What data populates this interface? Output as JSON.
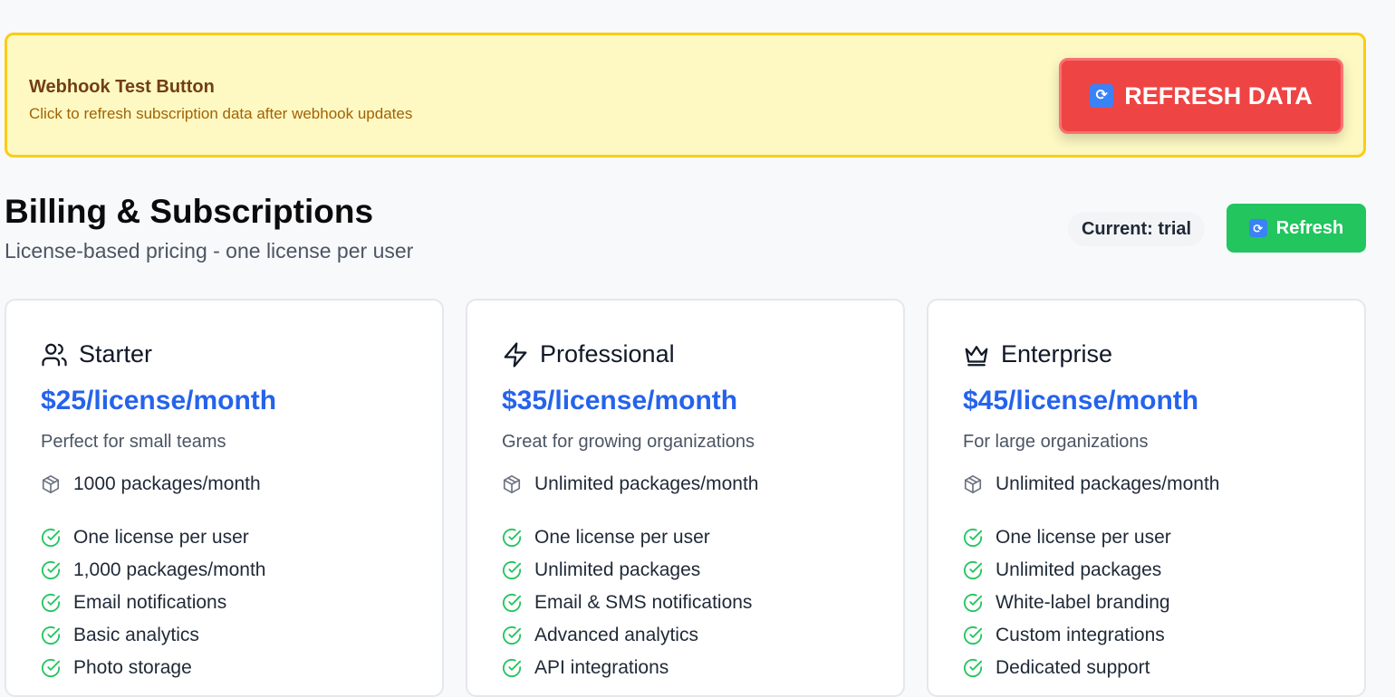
{
  "webhook_banner": {
    "title": "Webhook Test Button",
    "subtitle": "Click to refresh subscription data after webhook updates",
    "button_label": "REFRESH DATA",
    "button_icon": "🔄"
  },
  "header": {
    "title": "Billing & Subscriptions",
    "subtitle": "License-based pricing - one license per user",
    "current_plan": "Current: trial",
    "refresh_label": "Refresh",
    "refresh_icon": "🔄"
  },
  "plans": [
    {
      "icon": "users-icon",
      "name": "Starter",
      "price": "$25/license/month",
      "description": "Perfect for small teams",
      "quota": "1000 packages/month",
      "features": [
        "One license per user",
        "1,000 packages/month",
        "Email notifications",
        "Basic analytics",
        "Photo storage"
      ]
    },
    {
      "icon": "lightning-icon",
      "name": "Professional",
      "price": "$35/license/month",
      "description": "Great for growing organizations",
      "quota": "Unlimited packages/month",
      "features": [
        "One license per user",
        "Unlimited packages",
        "Email & SMS notifications",
        "Advanced analytics",
        "API integrations"
      ]
    },
    {
      "icon": "crown-icon",
      "name": "Enterprise",
      "price": "$45/license/month",
      "description": "For large organizations",
      "quota": "Unlimited packages/month",
      "features": [
        "One license per user",
        "Unlimited packages",
        "White-label branding",
        "Custom integrations",
        "Dedicated support"
      ]
    }
  ],
  "colors": {
    "banner_bg": "#fef9c3",
    "banner_border": "#facc15",
    "danger": "#ef4444",
    "success": "#22c55e",
    "price": "#2563eb",
    "check": "#22c55e"
  }
}
